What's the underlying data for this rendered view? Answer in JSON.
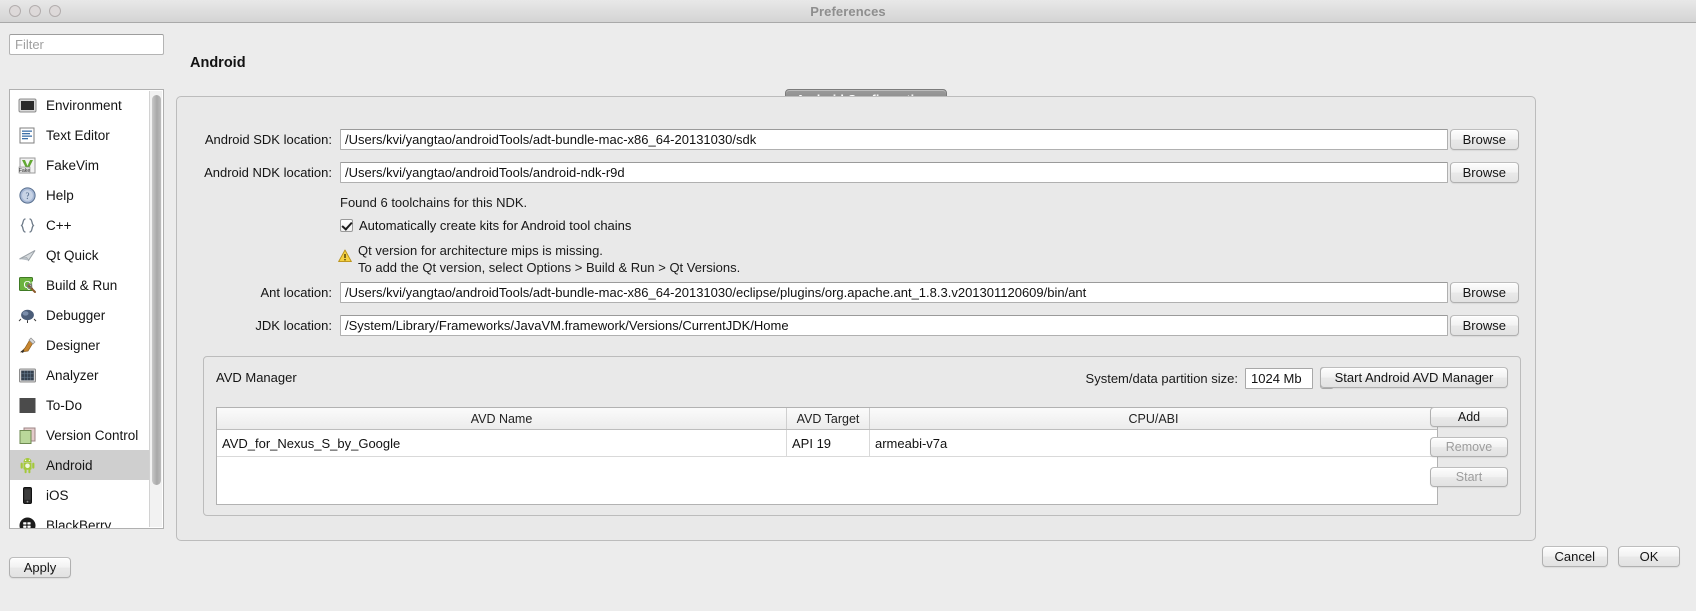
{
  "window": {
    "title": "Preferences",
    "traffic_lights": [
      "close",
      "minimize",
      "zoom"
    ]
  },
  "sidebar": {
    "filter": {
      "value": "",
      "placeholder": "Filter"
    },
    "items": [
      {
        "label": "Environment",
        "icon": "environment-icon",
        "selected": false
      },
      {
        "label": "Text Editor",
        "icon": "text-editor-icon",
        "selected": false
      },
      {
        "label": "FakeVim",
        "icon": "fakevim-icon",
        "selected": false
      },
      {
        "label": "Help",
        "icon": "help-icon",
        "selected": false
      },
      {
        "label": "C++",
        "icon": "cplusplus-icon",
        "selected": false
      },
      {
        "label": "Qt Quick",
        "icon": "qt-quick-icon",
        "selected": false
      },
      {
        "label": "Build & Run",
        "icon": "build-and-run-icon",
        "selected": false
      },
      {
        "label": "Debugger",
        "icon": "debugger-icon",
        "selected": false
      },
      {
        "label": "Designer",
        "icon": "designer-icon",
        "selected": false
      },
      {
        "label": "Analyzer",
        "icon": "analyzer-icon",
        "selected": false
      },
      {
        "label": "To-Do",
        "icon": "todo-icon",
        "selected": false
      },
      {
        "label": "Version Control",
        "icon": "version-control-icon",
        "selected": false
      },
      {
        "label": "Android",
        "icon": "android-icon",
        "selected": true
      },
      {
        "label": "iOS",
        "icon": "ios-icon",
        "selected": false
      },
      {
        "label": "BlackBerry",
        "icon": "blackberry-icon",
        "selected": false
      }
    ],
    "apply_label": "Apply"
  },
  "main": {
    "page_title": "Android",
    "group_tab_label": "Android Configurations",
    "fields": [
      {
        "label": "Android SDK location:",
        "value": "/Users/kvi/yangtao/androidTools/adt-bundle-mac-x86_64-20131030/sdk",
        "browse_label": "Browse"
      },
      {
        "label": "Android NDK location:",
        "value": "/Users/kvi/yangtao/androidTools/android-ndk-r9d",
        "browse_label": "Browse"
      },
      {
        "label": "Ant location:",
        "value": "/Users/kvi/yangtao/androidTools/adt-bundle-mac-x86_64-20131030/eclipse/plugins/org.apache.ant_1.8.3.v201301120609/bin/ant",
        "browse_label": "Browse"
      },
      {
        "label": "JDK location:",
        "value": "/System/Library/Frameworks/JavaVM.framework/Versions/CurrentJDK/Home",
        "browse_label": "Browse"
      }
    ],
    "toolchain_note": "Found 6 toolchains for this NDK.",
    "auto_kits_checkbox": {
      "label": "Automatically create kits for Android tool chains",
      "checked": true
    },
    "warning": {
      "icon": "warning-triangle-icon",
      "line1": "Qt version for architecture mips is missing.",
      "line2": "To add the Qt version, select Options > Build & Run > Qt Versions."
    }
  },
  "avd": {
    "title": "AVD Manager",
    "partition_label": "System/data partition size:",
    "partition_value": "1024 Mb",
    "start_manager_label": "Start Android AVD Manager",
    "columns": [
      "AVD Name",
      "AVD Target",
      "CPU/ABI"
    ],
    "rows": [
      {
        "name": "AVD_for_Nexus_S_by_Google",
        "target": "API 19",
        "abi": "armeabi-v7a"
      }
    ],
    "buttons": [
      {
        "label": "Add",
        "enabled": true
      },
      {
        "label": "Remove",
        "enabled": false
      },
      {
        "label": "Start",
        "enabled": false
      }
    ]
  },
  "footer": {
    "cancel_label": "Cancel",
    "ok_label": "OK"
  },
  "colors": {
    "window_bg": "#ececec",
    "panel_bg": "#e9e9e9",
    "selection": "#cfcfcf",
    "tab_bg": "#8c8c8c",
    "warning": "#e8b923"
  }
}
